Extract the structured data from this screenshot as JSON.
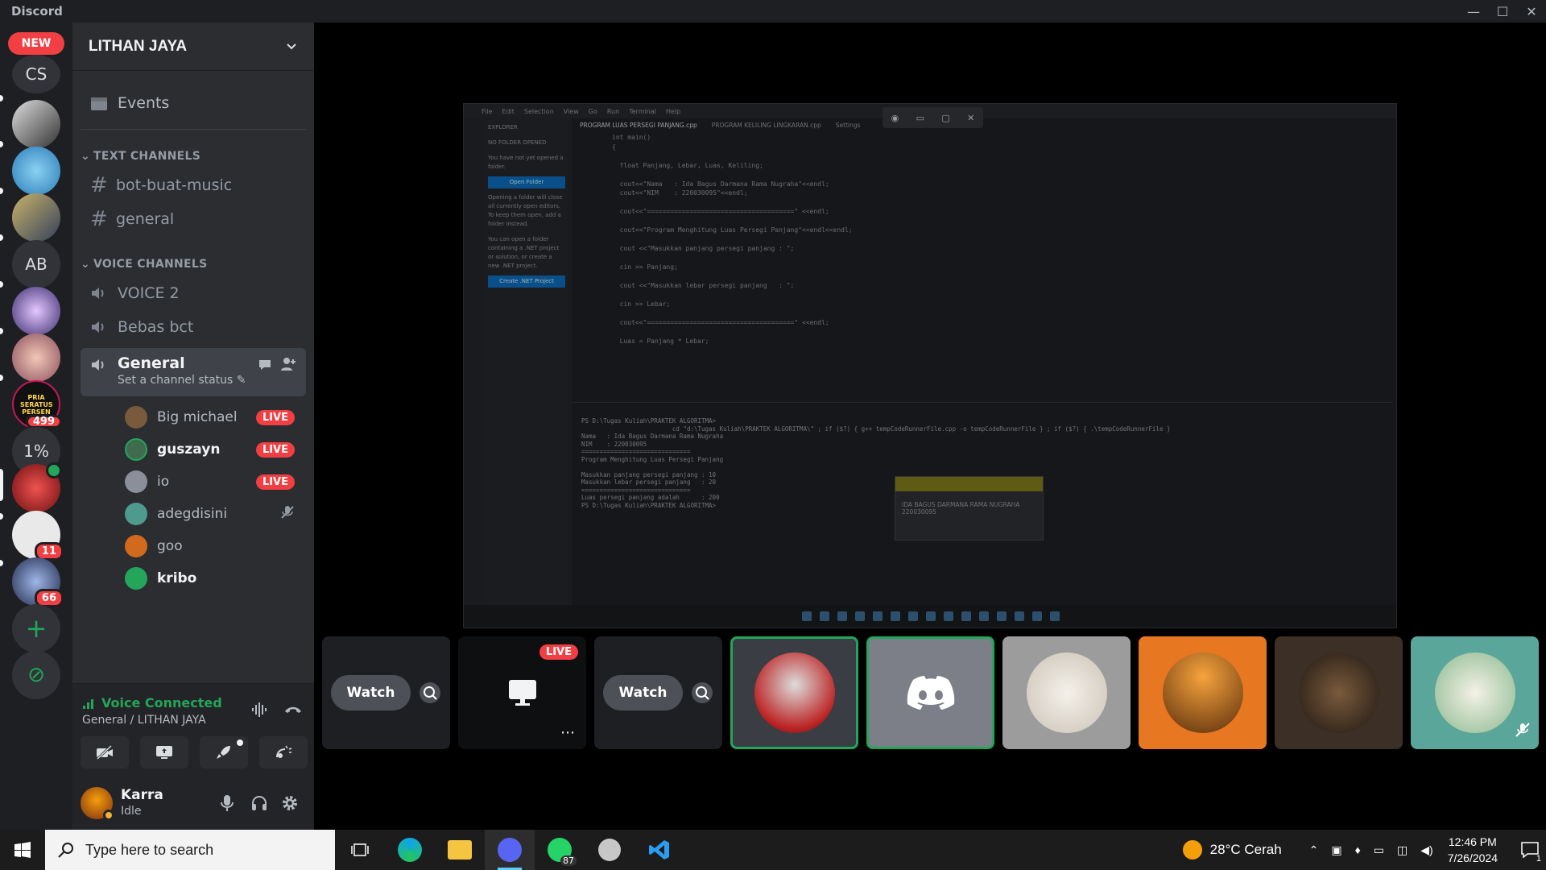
{
  "app": {
    "name": "Discord"
  },
  "window_controls": {
    "minimize": "—",
    "maximize": "☐",
    "close": "✕"
  },
  "rail": {
    "new_badge": "NEW",
    "servers": [
      {
        "label": "CS"
      },
      {
        "label": ""
      },
      {
        "label": ""
      },
      {
        "label": ""
      },
      {
        "label": "AB"
      },
      {
        "label": ""
      },
      {
        "label": ""
      },
      {
        "label": "PRIA SERATUS PERSEN",
        "badge": "499"
      },
      {
        "label": "1%"
      },
      {
        "label": ""
      },
      {
        "label": "",
        "badge": "11"
      },
      {
        "label": "",
        "badge": "66"
      }
    ],
    "add_server": "+",
    "discover": "⊘"
  },
  "guild": {
    "name": "LITHAN JAYA",
    "events_label": "Events",
    "text_category": "TEXT CHANNELS",
    "text_channels": [
      "bot-buat-music",
      "general"
    ],
    "voice_category": "VOICE CHANNELS",
    "voice_channels": [
      "VOICE 2",
      "Bebas bct"
    ],
    "active_voice": {
      "name": "General",
      "status_placeholder": "Set a channel status"
    },
    "members": [
      {
        "name": "Big michael",
        "live": "LIVE",
        "color": "#7a5a3c"
      },
      {
        "name": "guszayn",
        "live": "LIVE",
        "color": "#3f6b4e"
      },
      {
        "name": "io",
        "live": "LIVE",
        "color": "#8a8f99"
      },
      {
        "name": "adegdisini",
        "live": "",
        "color": "#4f9a8f"
      },
      {
        "name": "goo",
        "live": "",
        "color": "#d26a1e"
      },
      {
        "name": "kribo",
        "live": "",
        "color": "#23a55a"
      }
    ]
  },
  "voice": {
    "connected": "Voice Connected",
    "location": "General / LITHAN JAYA"
  },
  "user": {
    "name": "Karra",
    "status": "Idle"
  },
  "stage": {
    "tiles": [
      {
        "type": "watch",
        "label": "Watch"
      },
      {
        "type": "stream",
        "label": "LIVE"
      },
      {
        "type": "watch",
        "label": "Watch"
      },
      {
        "type": "avatar",
        "color": "#3a3d44",
        "speaking": true
      },
      {
        "type": "discord",
        "color": "#7c7f88",
        "speaking": true
      },
      {
        "type": "avatar",
        "color": "#9c9c9c",
        "speaking": false
      },
      {
        "type": "avatar",
        "color": "#e87722",
        "speaking": false
      },
      {
        "type": "avatar",
        "color": "#3b2f26",
        "speaking": false
      },
      {
        "type": "avatar",
        "color": "#5aa69b",
        "speaking": false
      }
    ]
  },
  "shared_screen": {
    "menu": [
      "File",
      "Edit",
      "Selection",
      "View",
      "Go",
      "Run",
      "Terminal",
      "Help"
    ],
    "tabs": [
      "PROGRAM LUAS PERSEGI PANJANG.cpp",
      "PROGRAM KELILING LINGKARAN.cpp",
      "Settings"
    ],
    "explorer": [
      "EXPLORER",
      "NO FOLDER OPENED",
      "You have not yet opened a folder.",
      "Open Folder",
      "Opening a folder will close all currently open editors. To keep them open, add a folder instead.",
      "You can open a folder containing a .NET project or solution, or create a new .NET project.",
      "Create .NET Project"
    ],
    "code": "int main()\n{\n\n  float Panjang, Lebar, Luas, Keliling;\n\n  cout<<\"Nama   : Ida Bagus Darmana Rama Nugraha\"<<endl;\n  cout<<\"NIM    : 220030095\"<<endl;\n\n  cout<<\"======================================\" <<endl;\n\n  cout<<\"Program Menghitung Luas Persegi Panjang\"<<endl<<endl;\n\n  cout <<\"Masukkan panjang persegi panjang : \";\n\n  cin >> Panjang;\n\n  cout <<\"Masukkan lebar persegi panjang   : \";\n\n  cin >> Lebar;\n\n  cout<<\"======================================\" <<endl;\n\n  Luas = Panjang * Lebar;",
    "terminal": "PS D:\\Tugas Kuliah\\PRAKTEK ALGORITMA>\n                         cd \"d:\\Tugas Kuliah\\PRAKTEK ALGORITMA\\\" ; if ($?) { g++ tempCodeRunnerFile.cpp -o tempCodeRunnerFile } ; if ($?) { .\\tempCodeRunnerFile }\nNama   : Ida Bagus Darmana Rama Nugraha\nNIM    : 220030095\n==============================\nProgram Menghitung Luas Persegi Panjang\n\nMasukkan panjang persegi panjang : 10\nMasukkan lebar persegi panjang   : 20\n==============================\nLuas persegi panjang adalah      : 200\nPS D:\\Tugas Kuliah\\PRAKTEK ALGORITMA> ",
    "popup": "IDA BAGUS DARMANA RAMA NUGRAHA\n220030095"
  },
  "taskbar": {
    "search_placeholder": "Type here to search",
    "whatsapp_count": "87",
    "weather": "28°C  Cerah",
    "time": "12:46 PM",
    "date": "7/26/2024",
    "notifications": "1"
  }
}
